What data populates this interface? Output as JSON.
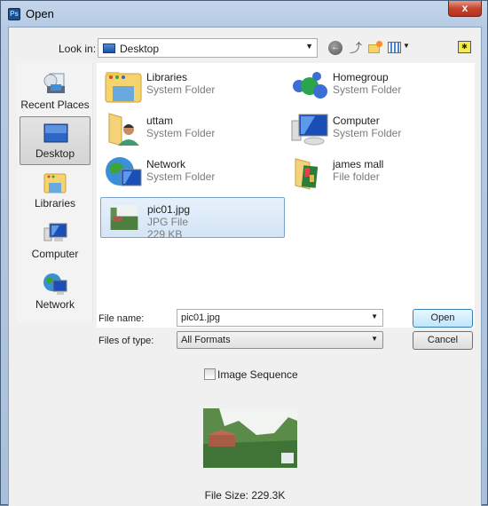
{
  "window": {
    "title": "Open",
    "app_icon": "ps-icon",
    "close_label": "x"
  },
  "toolbar": {
    "look_in_label": "Look in:",
    "look_in_value": "Desktop",
    "back_icon": "back-arrow-icon",
    "up_icon": "up-folder-icon",
    "new_folder_icon": "new-folder-icon",
    "view_menu_icon": "view-menu-icon",
    "right_icon": "bridge-folder-icon"
  },
  "places": [
    {
      "label": "Recent Places",
      "icon": "recent-places-icon",
      "selected": false
    },
    {
      "label": "Desktop",
      "icon": "desktop-icon",
      "selected": true
    },
    {
      "label": "Libraries",
      "icon": "libraries-icon",
      "selected": false
    },
    {
      "label": "Computer",
      "icon": "computer-icon",
      "selected": false
    },
    {
      "label": "Network",
      "icon": "network-icon",
      "selected": false
    }
  ],
  "files": [
    {
      "name": "Libraries",
      "type": "System Folder",
      "icon": "libraries-icon"
    },
    {
      "name": "Homegroup",
      "type": "System Folder",
      "icon": "homegroup-icon"
    },
    {
      "name": "uttam",
      "type": "System Folder",
      "icon": "user-folder-icon"
    },
    {
      "name": "Computer",
      "type": "System Folder",
      "icon": "computer-icon"
    },
    {
      "name": "Network",
      "type": "System Folder",
      "icon": "network-icon"
    },
    {
      "name": "james mall",
      "type": "File folder",
      "icon": "folder-icon"
    },
    {
      "name": "pic01.jpg",
      "type": "JPG File",
      "size": "229 KB",
      "icon": "image-thumbnail",
      "selected": true
    }
  ],
  "form": {
    "file_name_label": "File name:",
    "file_name_value": "pic01.jpg",
    "file_type_label": "Files of type:",
    "file_type_value": "All Formats",
    "open_label": "Open",
    "cancel_label": "Cancel",
    "image_sequence_label": "Image Sequence",
    "image_sequence_checked": false
  },
  "preview": {
    "file_size_text": "File Size: 229.3K"
  }
}
